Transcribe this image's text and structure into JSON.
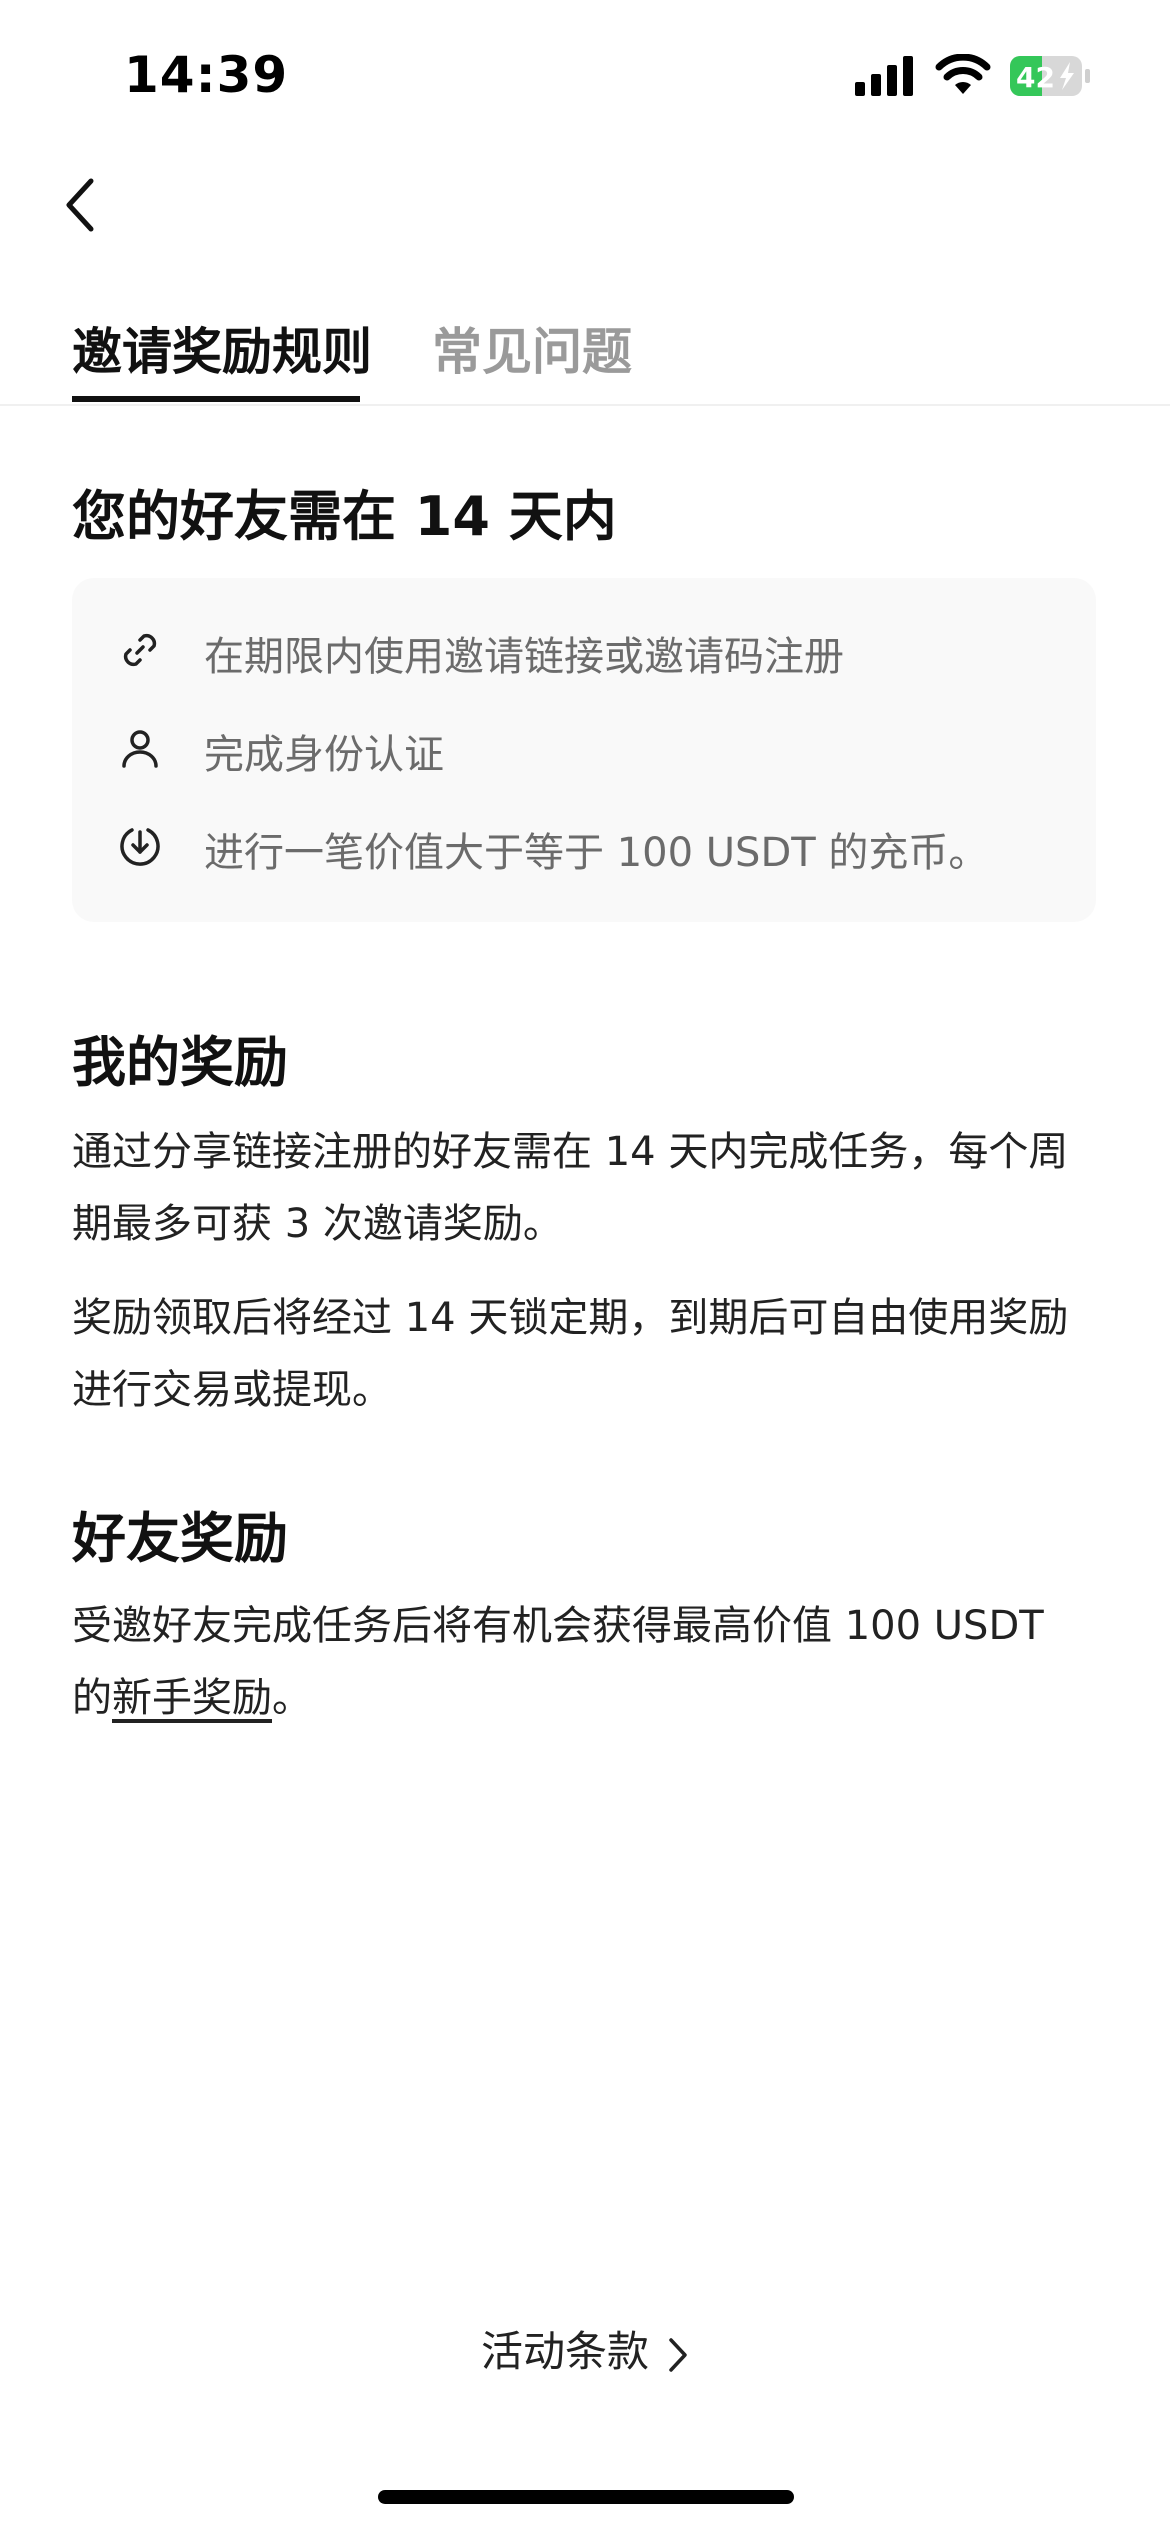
{
  "status_bar": {
    "time": "14:39",
    "battery": "42"
  },
  "nav": {
    "back_icon": "chevron-left-icon"
  },
  "tabs": [
    {
      "label": "邀请奖励规则",
      "active": true
    },
    {
      "label": "常见问题",
      "active": false
    }
  ],
  "requirements": {
    "title": "您的好友需在 14 天内",
    "items": [
      {
        "icon": "link-icon",
        "text": "在期限内使用邀请链接或邀请码注册"
      },
      {
        "icon": "user-icon",
        "text": "完成身份认证"
      },
      {
        "icon": "deposit-icon",
        "text": "进行一笔价值大于等于 100 USDT 的充币。"
      }
    ]
  },
  "my_reward": {
    "title": "我的奖励",
    "para1": "通过分享链接注册的好友需在 14 天内完成任务，每个周期最多可获 3 次邀请奖励。",
    "para2": "奖励领取后将经过 14 天锁定期，到期后可自由使用奖励进行交易或提现。"
  },
  "friend_reward": {
    "title": "好友奖励",
    "para_prefix": "受邀好友完成任务后将有机会获得最高价值 100 USDT 的",
    "link_text": "新手奖励",
    "para_suffix": "。"
  },
  "footer": {
    "terms_label": "活动条款"
  },
  "colors": {
    "text_primary": "#111111",
    "text_secondary": "#6b6b6b",
    "tab_inactive": "#9a9a9a",
    "card_bg": "#f9f9f9",
    "battery_green": "#34c759"
  }
}
